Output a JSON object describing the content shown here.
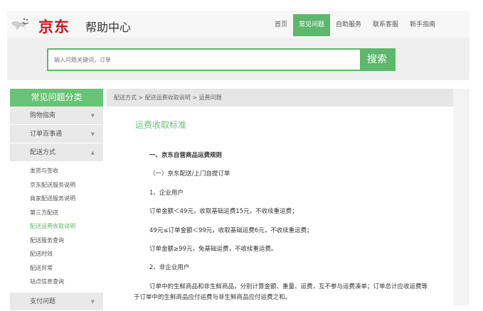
{
  "header": {
    "brand": "京东",
    "title": "帮助中心",
    "nav": [
      {
        "label": "首页"
      },
      {
        "label": "常见问题",
        "active": true
      },
      {
        "label": "自助服务"
      },
      {
        "label": "联系客服"
      },
      {
        "label": "新手指南"
      }
    ]
  },
  "search": {
    "placeholder": "输入问题关键词，订单",
    "button": "搜索"
  },
  "sidebar": {
    "title": "常见问题分类",
    "cats": [
      "购物指南",
      "订单百事通",
      "配送方式",
      "支付问题"
    ],
    "subs": [
      "发货与签收",
      "京东配送服务说明",
      "商家配送服务说明",
      "第三方配送",
      "配送运费收取说明",
      "配送服务查询",
      "配送时效",
      "配送异常",
      "站点信息查询"
    ]
  },
  "breadcrumb": "配送方式 > 配送运费收取说明 > 运费问题",
  "article": {
    "title": "运费收取标准",
    "lines": [
      "一、京东自营商品运费规则",
      "（一）京东配送/上门自提订单",
      "1、企业用户",
      "订单金额＜49元，收取基础运费15元，不收续重运费；",
      "49元≤订单金额＜99元，收取基础运费6元，不收续重运费；",
      "订单金额≥99元，免基础运费，不收续重运费。",
      "2、非企业用户"
    ],
    "paragraph": "订单中的生鲜商品和非生鲜商品，分别计算金额、重量、运费，互不参与运费凑单；订单总计应收运费等于订单中的生鲜商品应付运费与非生鲜商品应付运费之和。"
  },
  "colors": {
    "accent": "#5cb86a",
    "brand": "#c9151e"
  }
}
